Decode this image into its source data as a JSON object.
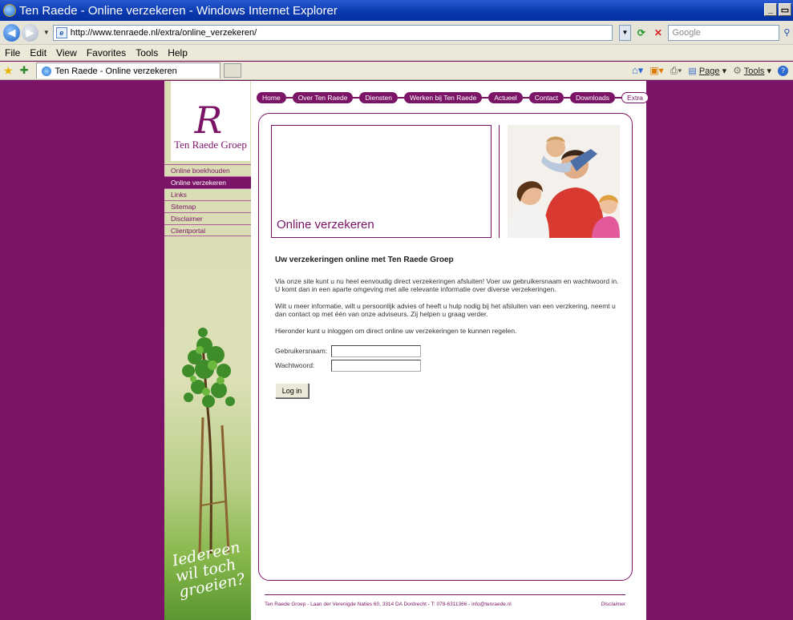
{
  "window": {
    "title": "Ten Raede - Online verzekeren - Windows Internet Explorer",
    "min_label": "_",
    "restore_label": "▭"
  },
  "address": {
    "url": "http://www.tenraede.nl/extra/online_verzekeren/",
    "search_placeholder": "Google"
  },
  "menu": {
    "items": [
      "File",
      "Edit",
      "View",
      "Favorites",
      "Tools",
      "Help"
    ]
  },
  "tabs": {
    "active_tab": "Ten Raede - Online verzekeren",
    "page_label": "Page",
    "tools_label": "Tools"
  },
  "site": {
    "logo_letter": "R",
    "logo_name": "Ten Raede Groep",
    "topnav": [
      "Home",
      "Over Ten Raede",
      "Diensten",
      "Werken bij Ten Raede",
      "Actueel",
      "Contact",
      "Downloads",
      "Extra"
    ],
    "subnav": [
      {
        "label": "Online boekhouden",
        "active": false
      },
      {
        "label": "Online verzekeren",
        "active": true
      },
      {
        "label": "Links",
        "active": false
      },
      {
        "label": "Sitemap",
        "active": false
      },
      {
        "label": "Disclaimer",
        "active": false
      },
      {
        "label": "Clientportal",
        "active": false
      }
    ],
    "slogan": [
      "Iedereen",
      "wil toch",
      "groeien?"
    ],
    "header_title": "Online verzekeren",
    "heading": "Uw verzekeringen online met Ten Raede Groep",
    "paragraphs": [
      "Via onze site kunt u nu heel eenvoudig direct verzekeringen afsluiten! Voer uw gebruikersnaam en wachtwoord in. U komt dan in een aparte omgeving met alle relevante informatie over diverse verzekeringen.",
      "Wilt u meer informatie, wilt u persoonlijk advies of heeft u hulp nodig bij het afsluiten van een verzkering, neemt u dan contact op met één van onze adviseurs. Zij helpen u graag verder.",
      "Hieronder kunt u inloggen om direct online uw verzekeringen te kunnen regelen."
    ],
    "form": {
      "username_label": "Gebruikersnaam:",
      "username_value": "",
      "password_label": "Wachtwoord:",
      "password_value": "",
      "submit_label": "Log in"
    },
    "footer": {
      "address": "Ten Raede Groep - Laan der Verenigde Naties 60, 3314 DA Dordrecht - T: 078-6311366 - info@tenraede.nl",
      "disclaimer": "Disclaimer"
    },
    "colors": {
      "brand": "#7b1466",
      "background": "#7b1466"
    }
  }
}
